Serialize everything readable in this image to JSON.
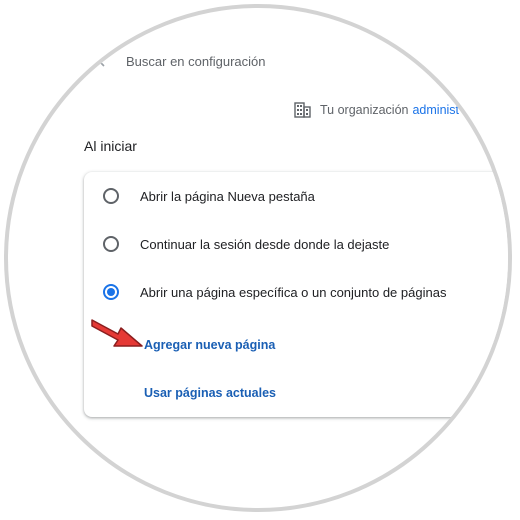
{
  "search": {
    "placeholder": "Buscar en configuración"
  },
  "org": {
    "text": "Tu organización",
    "link": "administ"
  },
  "section": {
    "title": "Al iniciar"
  },
  "options": [
    {
      "label": "Abrir la página Nueva pestaña",
      "checked": false
    },
    {
      "label": "Continuar la sesión desde donde la dejaste",
      "checked": false
    },
    {
      "label": "Abrir una página específica o un conjunto de páginas",
      "checked": true
    }
  ],
  "actions": {
    "add_page": "Agregar nueva página",
    "use_current": "Usar páginas actuales"
  },
  "colors": {
    "accent": "#1a73e8",
    "arrow": "#e53935",
    "frame": "#d3d3d3"
  },
  "icons": {
    "back": "chevron-left-icon",
    "org": "building-icon",
    "pointer": "red-arrow-icon"
  }
}
